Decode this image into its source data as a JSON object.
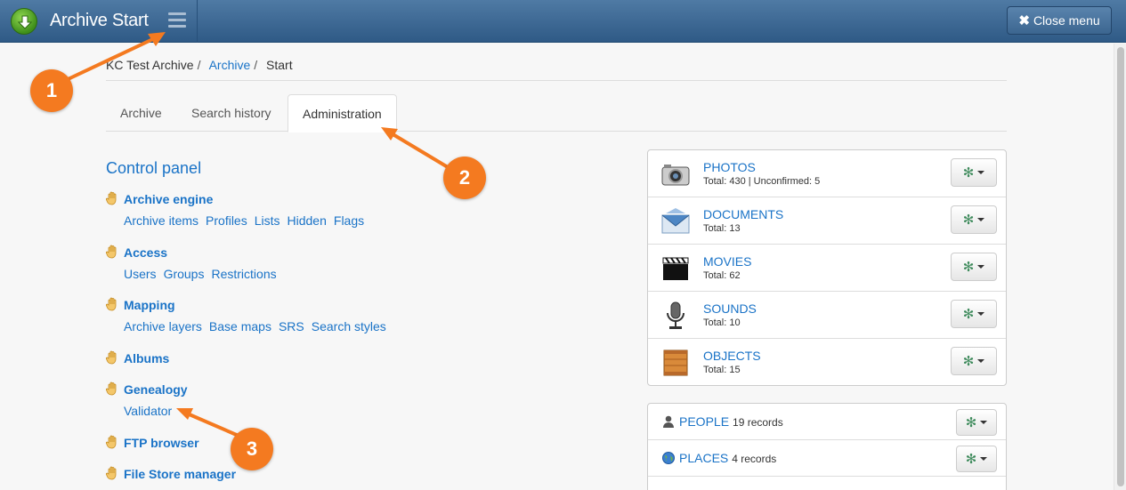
{
  "header": {
    "title": "Archive Start",
    "close_menu_label": "Close menu"
  },
  "breadcrumb": {
    "root": "KC Test Archive",
    "archive": "Archive",
    "current": "Start"
  },
  "tabs": [
    {
      "label": "Archive"
    },
    {
      "label": "Search history"
    },
    {
      "label": "Administration",
      "active": true
    }
  ],
  "control_panel": {
    "title": "Control panel",
    "sections": [
      {
        "label": "Archive engine",
        "links": [
          "Archive items",
          "Profiles",
          "Lists",
          "Hidden",
          "Flags"
        ]
      },
      {
        "label": "Access",
        "links": [
          "Users",
          "Groups",
          "Restrictions"
        ]
      },
      {
        "label": "Mapping",
        "links": [
          "Archive layers",
          "Base maps",
          "SRS",
          "Search styles"
        ]
      },
      {
        "label": "Albums",
        "links": []
      },
      {
        "label": "Genealogy",
        "links": [
          "Validator"
        ]
      },
      {
        "label": "FTP browser",
        "links": []
      },
      {
        "label": "File Store manager",
        "links": []
      }
    ]
  },
  "media": [
    {
      "name": "PHOTOS",
      "total": "Total: 430 | Unconfirmed: 5",
      "icon": "camera-icon"
    },
    {
      "name": "DOCUMENTS",
      "total": "Total: 13",
      "icon": "envelope-icon"
    },
    {
      "name": "MOVIES",
      "total": "Total: 62",
      "icon": "clapperboard-icon"
    },
    {
      "name": "SOUNDS",
      "total": "Total: 10",
      "icon": "microphone-icon"
    },
    {
      "name": "OBJECTS",
      "total": "Total: 15",
      "icon": "crate-icon"
    }
  ],
  "people_places": [
    {
      "name": "PEOPLE",
      "count": "19 records",
      "icon": "person-icon"
    },
    {
      "name": "PLACES",
      "count": "4 records",
      "icon": "globe-icon"
    }
  ],
  "annotations": [
    "1",
    "2",
    "3"
  ],
  "colors": {
    "accent": "#f47a20",
    "link": "#1a73c7",
    "header": "#3d6891"
  }
}
